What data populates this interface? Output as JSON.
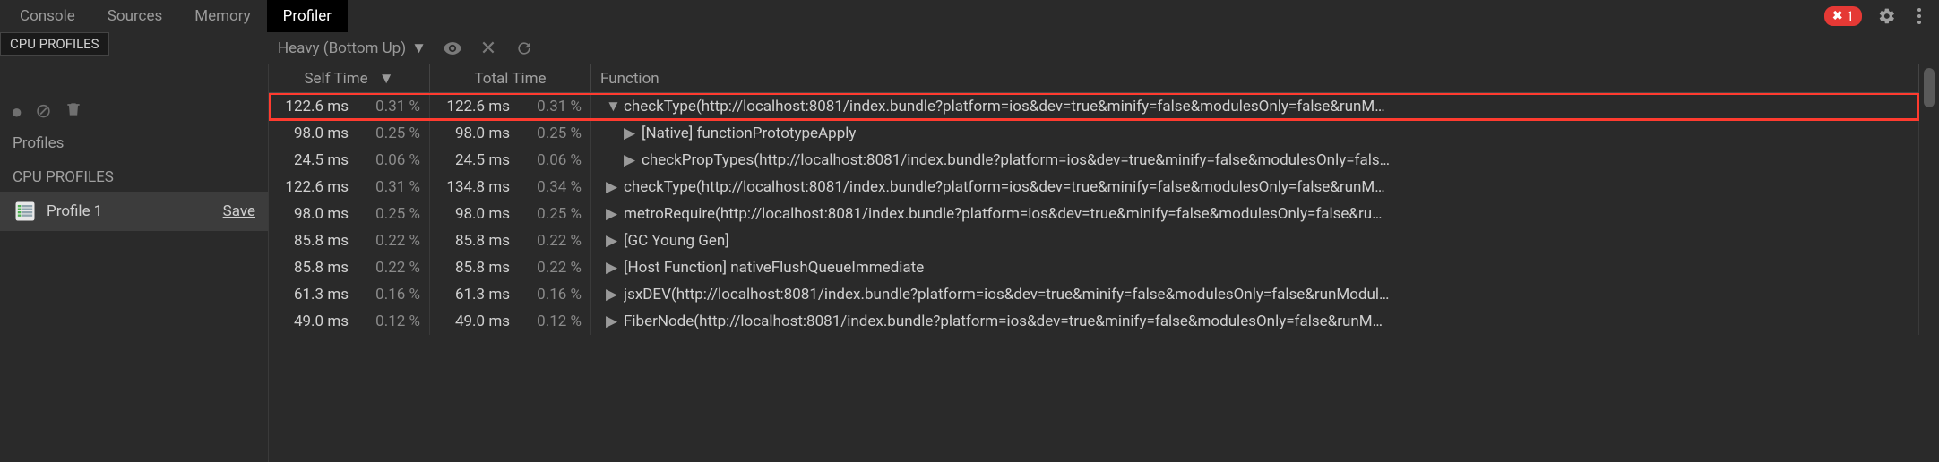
{
  "tabs": [
    {
      "label": "Console"
    },
    {
      "label": "Sources"
    },
    {
      "label": "Memory"
    },
    {
      "label": "Profiler"
    }
  ],
  "active_tab_index": 3,
  "error_count": "1",
  "subheader": {
    "cpu_profiles_chip": "CPU PROFILES",
    "view_dropdown": "Heavy (Bottom Up)"
  },
  "sidebar": {
    "section_label": "Profiles",
    "group_label": "CPU PROFILES",
    "items": [
      {
        "label": "Profile 1",
        "action": "Save"
      }
    ]
  },
  "table": {
    "columns": {
      "self": "Self Time",
      "total": "Total Time",
      "func": "Function"
    },
    "rows": [
      {
        "self_ms": "122.6 ms",
        "self_pct": "0.31 %",
        "total_ms": "122.6 ms",
        "total_pct": "0.31 %",
        "indent": 0,
        "expanded": true,
        "highlighted": true,
        "name": "checkType(http://localhost:8081/index.bundle?platform=ios&dev=true&minify=false&modulesOnly=false&runM…"
      },
      {
        "self_ms": "98.0 ms",
        "self_pct": "0.25 %",
        "total_ms": "98.0 ms",
        "total_pct": "0.25 %",
        "indent": 1,
        "expanded": false,
        "highlighted": false,
        "name": "[Native] functionPrototypeApply"
      },
      {
        "self_ms": "24.5 ms",
        "self_pct": "0.06 %",
        "total_ms": "24.5 ms",
        "total_pct": "0.06 %",
        "indent": 1,
        "expanded": false,
        "highlighted": false,
        "name": "checkPropTypes(http://localhost:8081/index.bundle?platform=ios&dev=true&minify=false&modulesOnly=fals…"
      },
      {
        "self_ms": "122.6 ms",
        "self_pct": "0.31 %",
        "total_ms": "134.8 ms",
        "total_pct": "0.34 %",
        "indent": 0,
        "expanded": false,
        "highlighted": false,
        "name": "checkType(http://localhost:8081/index.bundle?platform=ios&dev=true&minify=false&modulesOnly=false&runM…"
      },
      {
        "self_ms": "98.0 ms",
        "self_pct": "0.25 %",
        "total_ms": "98.0 ms",
        "total_pct": "0.25 %",
        "indent": 0,
        "expanded": false,
        "highlighted": false,
        "name": "metroRequire(http://localhost:8081/index.bundle?platform=ios&dev=true&minify=false&modulesOnly=false&ru…"
      },
      {
        "self_ms": "85.8 ms",
        "self_pct": "0.22 %",
        "total_ms": "85.8 ms",
        "total_pct": "0.22 %",
        "indent": 0,
        "expanded": false,
        "highlighted": false,
        "name": "[GC Young Gen]"
      },
      {
        "self_ms": "85.8 ms",
        "self_pct": "0.22 %",
        "total_ms": "85.8 ms",
        "total_pct": "0.22 %",
        "indent": 0,
        "expanded": false,
        "highlighted": false,
        "name": "[Host Function] nativeFlushQueueImmediate"
      },
      {
        "self_ms": "61.3 ms",
        "self_pct": "0.16 %",
        "total_ms": "61.3 ms",
        "total_pct": "0.16 %",
        "indent": 0,
        "expanded": false,
        "highlighted": false,
        "name": "jsxDEV(http://localhost:8081/index.bundle?platform=ios&dev=true&minify=false&modulesOnly=false&runModul…"
      },
      {
        "self_ms": "49.0 ms",
        "self_pct": "0.12 %",
        "total_ms": "49.0 ms",
        "total_pct": "0.12 %",
        "indent": 0,
        "expanded": false,
        "highlighted": false,
        "name": "FiberNode(http://localhost:8081/index.bundle?platform=ios&dev=true&minify=false&modulesOnly=false&runM…"
      }
    ]
  }
}
